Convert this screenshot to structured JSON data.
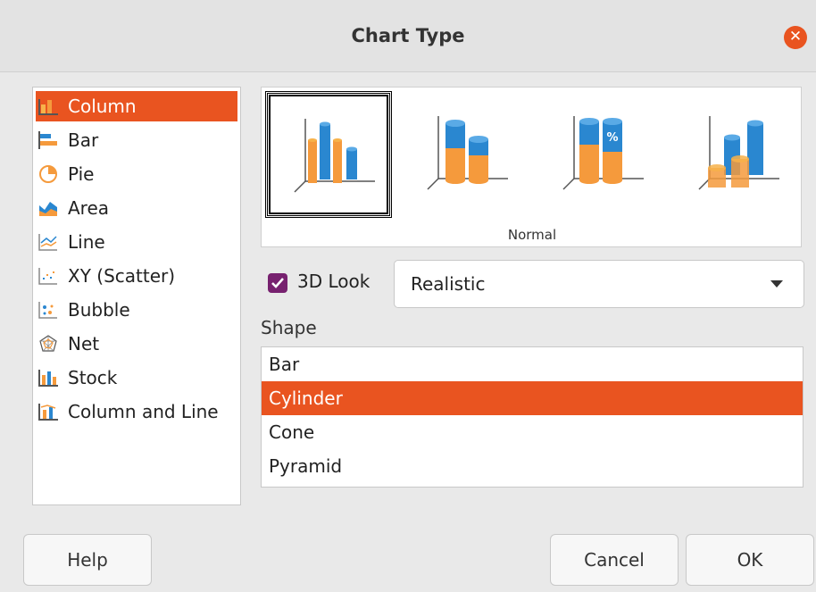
{
  "window": {
    "title": "Chart Type"
  },
  "chart_types": [
    {
      "label": "Column",
      "icon": "column-chart-icon",
      "selected": true
    },
    {
      "label": "Bar",
      "icon": "bar-chart-icon",
      "selected": false
    },
    {
      "label": "Pie",
      "icon": "pie-chart-icon",
      "selected": false
    },
    {
      "label": "Area",
      "icon": "area-chart-icon",
      "selected": false
    },
    {
      "label": "Line",
      "icon": "line-chart-icon",
      "selected": false
    },
    {
      "label": "XY (Scatter)",
      "icon": "scatter-chart-icon",
      "selected": false
    },
    {
      "label": "Bubble",
      "icon": "bubble-chart-icon",
      "selected": false
    },
    {
      "label": "Net",
      "icon": "net-chart-icon",
      "selected": false
    },
    {
      "label": "Stock",
      "icon": "stock-chart-icon",
      "selected": false
    },
    {
      "label": "Column and Line",
      "icon": "column-line-chart-icon",
      "selected": false
    }
  ],
  "variants": {
    "caption": "Normal",
    "items": [
      {
        "name": "normal",
        "selected": true
      },
      {
        "name": "stacked",
        "selected": false
      },
      {
        "name": "percent-stacked",
        "selected": false,
        "badge": "%"
      },
      {
        "name": "deep",
        "selected": false
      }
    ]
  },
  "look3d": {
    "label": "3D Look",
    "checked": true,
    "value": "Realistic"
  },
  "shape": {
    "label": "Shape",
    "options": [
      "Bar",
      "Cylinder",
      "Cone",
      "Pyramid"
    ],
    "selected": "Cylinder"
  },
  "buttons": {
    "help": "Help",
    "cancel": "Cancel",
    "ok": "OK"
  },
  "colors": {
    "accent": "#e95420",
    "checkbox": "#77216f",
    "series_orange": "#f59a3c",
    "series_blue": "#2a87d0"
  }
}
